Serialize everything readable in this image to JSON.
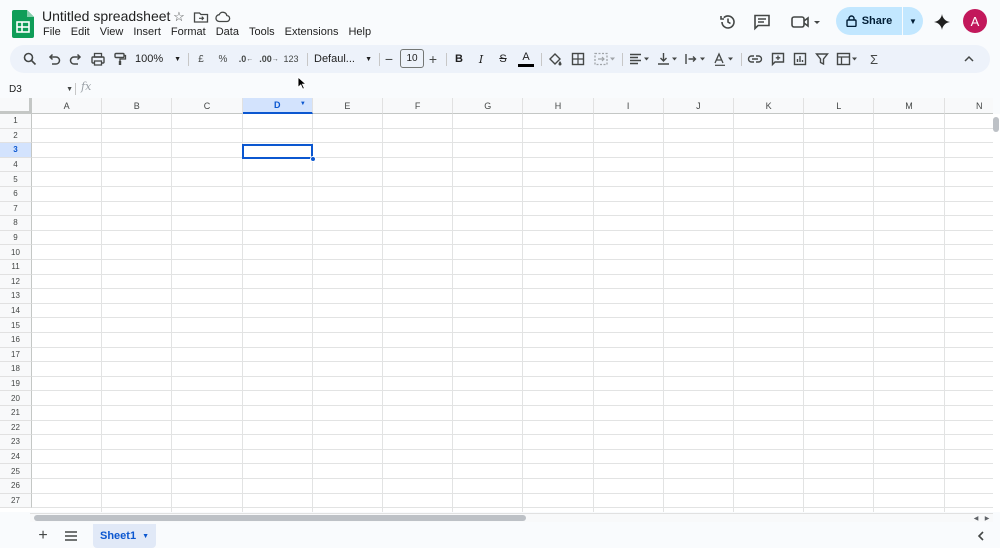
{
  "app": {
    "title": "Untitled spreadsheet",
    "menu": [
      "File",
      "Edit",
      "View",
      "Insert",
      "Format",
      "Data",
      "Tools",
      "Extensions",
      "Help"
    ],
    "share_label": "Share",
    "avatar_letter": "A",
    "colors": {
      "accent": "#0b57d0",
      "share_bg": "#c2e7ff",
      "avatar": "#c2185b",
      "logo": "#0f9d58"
    }
  },
  "toolbar": {
    "zoom": "100%",
    "currency": "£",
    "percent": "%",
    "decrease_decimal": ".0",
    "increase_decimal": ".00",
    "number_format": "123",
    "font": "Defaul...",
    "font_size": "10",
    "bold": "B",
    "italic": "I",
    "strikethrough": "S",
    "text_color": "A",
    "sum": "Σ"
  },
  "formula_bar": {
    "cell_ref": "D3",
    "fx": "fx"
  },
  "grid": {
    "columns": [
      "A",
      "B",
      "C",
      "D",
      "E",
      "F",
      "G",
      "H",
      "I",
      "J",
      "K",
      "L",
      "M",
      "N"
    ],
    "rows": [
      "1",
      "2",
      "3",
      "4",
      "5",
      "6",
      "7",
      "8",
      "9",
      "10",
      "11",
      "12",
      "13",
      "14",
      "15",
      "16",
      "17",
      "18",
      "19",
      "20",
      "21",
      "22",
      "23",
      "24",
      "25",
      "26",
      "27"
    ],
    "selected_column": "D",
    "selected_row": "3"
  },
  "sheets": [
    {
      "name": "Sheet1",
      "active": true
    }
  ]
}
